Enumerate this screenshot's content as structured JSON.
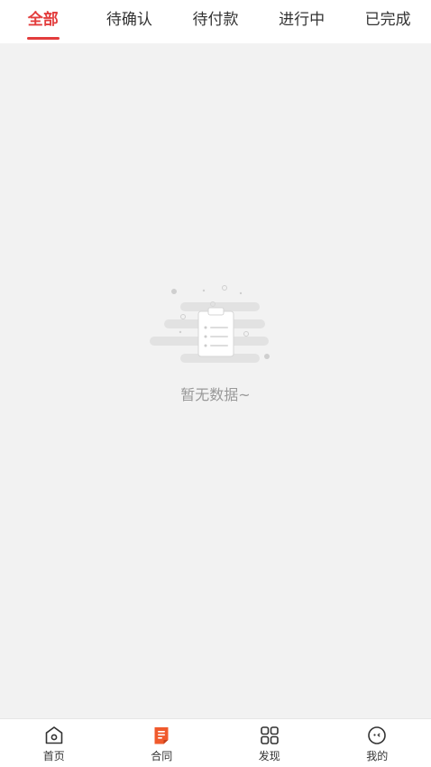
{
  "tabs": [
    {
      "label": "全部",
      "active": true
    },
    {
      "label": "待确认",
      "active": false
    },
    {
      "label": "待付款",
      "active": false
    },
    {
      "label": "进行中",
      "active": false
    },
    {
      "label": "已完成",
      "active": false
    }
  ],
  "empty_state": {
    "text": "暂无数据~",
    "icon": "clipboard-list-icon"
  },
  "bottom_nav": [
    {
      "label": "首页",
      "icon": "home-icon"
    },
    {
      "label": "合同",
      "icon": "contract-icon",
      "active": true
    },
    {
      "label": "发现",
      "icon": "grid-icon"
    },
    {
      "label": "我的",
      "icon": "profile-icon"
    }
  ],
  "colors": {
    "accent": "#e33c3c",
    "active_icon": "#f05a2c",
    "background": "#f2f2f2",
    "text": "#333333",
    "muted_text": "#999999"
  }
}
